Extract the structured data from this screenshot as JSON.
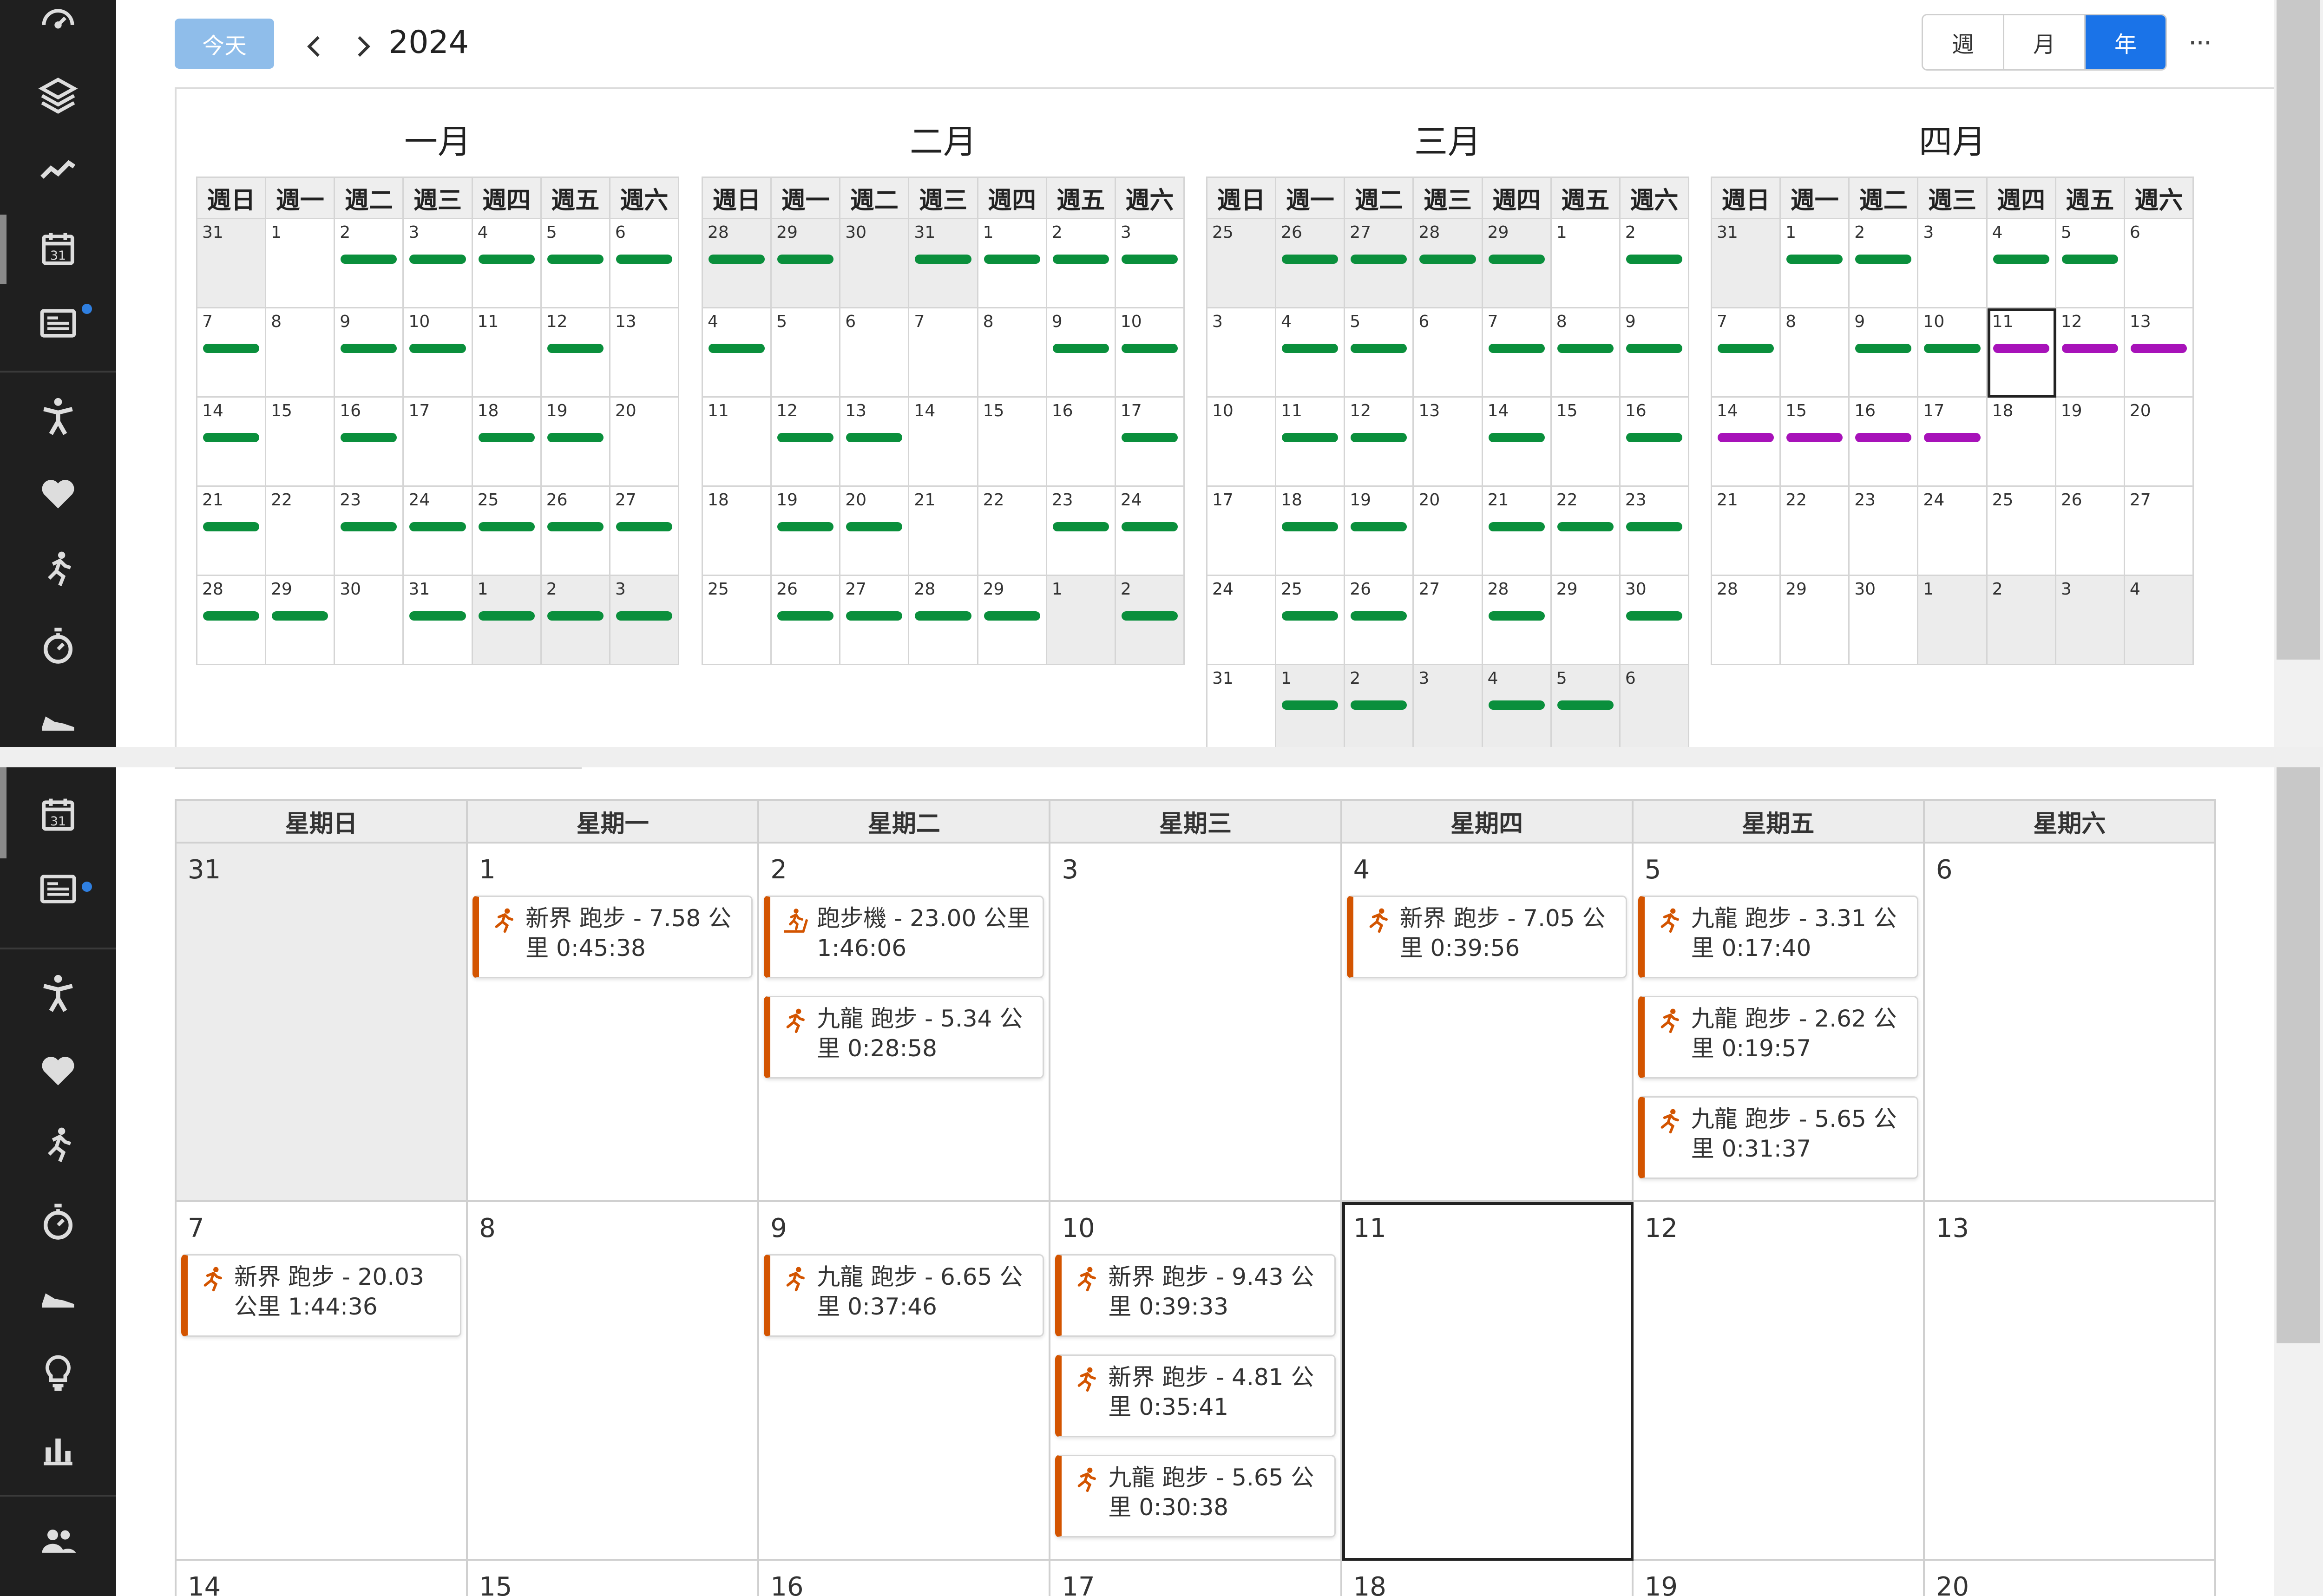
{
  "toolbar": {
    "today_label": "今天",
    "year": "2024",
    "views": [
      "週",
      "月",
      "年"
    ],
    "active_view": "年",
    "more_label": "···"
  },
  "colors": {
    "activity_bar": "#0a8f3c",
    "planned_bar": "#a712b9",
    "accent": "#1a73e8",
    "event_border": "#d35400"
  },
  "icons": {
    "sidebar_top": [
      "dashboard-icon",
      "layers-icon",
      "trend-icon",
      "calendar-icon",
      "news-icon",
      "activity-person-icon",
      "heart-icon",
      "run-icon",
      "stopwatch-icon",
      "shoe-icon"
    ],
    "sidebar_bottom": [
      "calendar-icon",
      "news-icon",
      "activity-person-icon",
      "heart-icon",
      "run-icon",
      "stopwatch-icon",
      "shoe-icon",
      "bulb-icon",
      "bar-chart-icon",
      "people-icon"
    ],
    "event": "running-icon",
    "event_treadmill": "treadmill-icon"
  },
  "year_view": {
    "weekday_headers": [
      "週日",
      "週一",
      "週二",
      "週三",
      "週四",
      "週五",
      "週六"
    ],
    "months": [
      {
        "name": "一月",
        "weeks": [
          [
            {
              "d": "31",
              "out": true
            },
            {
              "d": "1"
            },
            {
              "d": "2",
              "bar": "g"
            },
            {
              "d": "3",
              "bar": "g"
            },
            {
              "d": "4",
              "bar": "g"
            },
            {
              "d": "5",
              "bar": "g"
            },
            {
              "d": "6",
              "bar": "g"
            }
          ],
          [
            {
              "d": "7",
              "bar": "g"
            },
            {
              "d": "8"
            },
            {
              "d": "9",
              "bar": "g"
            },
            {
              "d": "10",
              "bar": "g"
            },
            {
              "d": "11"
            },
            {
              "d": "12",
              "bar": "g"
            },
            {
              "d": "13"
            }
          ],
          [
            {
              "d": "14",
              "bar": "g"
            },
            {
              "d": "15"
            },
            {
              "d": "16",
              "bar": "g"
            },
            {
              "d": "17"
            },
            {
              "d": "18",
              "bar": "g"
            },
            {
              "d": "19",
              "bar": "g"
            },
            {
              "d": "20"
            }
          ],
          [
            {
              "d": "21",
              "bar": "g"
            },
            {
              "d": "22"
            },
            {
              "d": "23",
              "bar": "g"
            },
            {
              "d": "24",
              "bar": "g"
            },
            {
              "d": "25",
              "bar": "g"
            },
            {
              "d": "26",
              "bar": "g"
            },
            {
              "d": "27",
              "bar": "g"
            }
          ],
          [
            {
              "d": "28",
              "bar": "g"
            },
            {
              "d": "29",
              "bar": "g"
            },
            {
              "d": "30"
            },
            {
              "d": "31",
              "bar": "g"
            },
            {
              "d": "1",
              "out": true,
              "bar": "g"
            },
            {
              "d": "2",
              "out": true,
              "bar": "g"
            },
            {
              "d": "3",
              "out": true,
              "bar": "g"
            }
          ]
        ]
      },
      {
        "name": "二月",
        "weeks": [
          [
            {
              "d": "28",
              "out": true,
              "bar": "g"
            },
            {
              "d": "29",
              "out": true,
              "bar": "g"
            },
            {
              "d": "30",
              "out": true
            },
            {
              "d": "31",
              "out": true,
              "bar": "g"
            },
            {
              "d": "1",
              "bar": "g"
            },
            {
              "d": "2",
              "bar": "g"
            },
            {
              "d": "3",
              "bar": "g"
            }
          ],
          [
            {
              "d": "4",
              "bar": "g"
            },
            {
              "d": "5"
            },
            {
              "d": "6"
            },
            {
              "d": "7"
            },
            {
              "d": "8"
            },
            {
              "d": "9",
              "bar": "g"
            },
            {
              "d": "10",
              "bar": "g"
            }
          ],
          [
            {
              "d": "11"
            },
            {
              "d": "12",
              "bar": "g"
            },
            {
              "d": "13",
              "bar": "g"
            },
            {
              "d": "14"
            },
            {
              "d": "15"
            },
            {
              "d": "16"
            },
            {
              "d": "17",
              "bar": "g"
            }
          ],
          [
            {
              "d": "18"
            },
            {
              "d": "19",
              "bar": "g"
            },
            {
              "d": "20",
              "bar": "g"
            },
            {
              "d": "21"
            },
            {
              "d": "22"
            },
            {
              "d": "23",
              "bar": "g"
            },
            {
              "d": "24",
              "bar": "g"
            }
          ],
          [
            {
              "d": "25"
            },
            {
              "d": "26",
              "bar": "g"
            },
            {
              "d": "27",
              "bar": "g"
            },
            {
              "d": "28",
              "bar": "g"
            },
            {
              "d": "29",
              "bar": "g"
            },
            {
              "d": "1",
              "out": true
            },
            {
              "d": "2",
              "out": true,
              "bar": "g"
            }
          ]
        ]
      },
      {
        "name": "三月",
        "weeks": [
          [
            {
              "d": "25",
              "out": true
            },
            {
              "d": "26",
              "out": true,
              "bar": "g"
            },
            {
              "d": "27",
              "out": true,
              "bar": "g"
            },
            {
              "d": "28",
              "out": true,
              "bar": "g"
            },
            {
              "d": "29",
              "out": true,
              "bar": "g"
            },
            {
              "d": "1"
            },
            {
              "d": "2",
              "bar": "g"
            }
          ],
          [
            {
              "d": "3"
            },
            {
              "d": "4",
              "bar": "g"
            },
            {
              "d": "5",
              "bar": "g"
            },
            {
              "d": "6"
            },
            {
              "d": "7",
              "bar": "g"
            },
            {
              "d": "8",
              "bar": "g"
            },
            {
              "d": "9",
              "bar": "g"
            }
          ],
          [
            {
              "d": "10"
            },
            {
              "d": "11",
              "bar": "g"
            },
            {
              "d": "12",
              "bar": "g"
            },
            {
              "d": "13"
            },
            {
              "d": "14",
              "bar": "g"
            },
            {
              "d": "15"
            },
            {
              "d": "16",
              "bar": "g"
            }
          ],
          [
            {
              "d": "17"
            },
            {
              "d": "18",
              "bar": "g"
            },
            {
              "d": "19",
              "bar": "g"
            },
            {
              "d": "20"
            },
            {
              "d": "21",
              "bar": "g"
            },
            {
              "d": "22",
              "bar": "g"
            },
            {
              "d": "23",
              "bar": "g"
            }
          ],
          [
            {
              "d": "24"
            },
            {
              "d": "25",
              "bar": "g"
            },
            {
              "d": "26",
              "bar": "g"
            },
            {
              "d": "27"
            },
            {
              "d": "28",
              "bar": "g"
            },
            {
              "d": "29"
            },
            {
              "d": "30",
              "bar": "g"
            }
          ],
          [
            {
              "d": "31"
            },
            {
              "d": "1",
              "out": true,
              "bar": "g"
            },
            {
              "d": "2",
              "out": true,
              "bar": "g"
            },
            {
              "d": "3",
              "out": true
            },
            {
              "d": "4",
              "out": true,
              "bar": "g"
            },
            {
              "d": "5",
              "out": true,
              "bar": "g"
            },
            {
              "d": "6",
              "out": true
            }
          ]
        ]
      },
      {
        "name": "四月",
        "weeks": [
          [
            {
              "d": "31",
              "out": true
            },
            {
              "d": "1",
              "bar": "g"
            },
            {
              "d": "2",
              "bar": "g"
            },
            {
              "d": "3"
            },
            {
              "d": "4",
              "bar": "g"
            },
            {
              "d": "5",
              "bar": "g"
            },
            {
              "d": "6"
            }
          ],
          [
            {
              "d": "7",
              "bar": "g"
            },
            {
              "d": "8"
            },
            {
              "d": "9",
              "bar": "g"
            },
            {
              "d": "10",
              "bar": "g"
            },
            {
              "d": "11",
              "bar": "p",
              "today": true
            },
            {
              "d": "12",
              "bar": "p"
            },
            {
              "d": "13",
              "bar": "p"
            }
          ],
          [
            {
              "d": "14",
              "bar": "p"
            },
            {
              "d": "15",
              "bar": "p"
            },
            {
              "d": "16",
              "bar": "p"
            },
            {
              "d": "17",
              "bar": "p"
            },
            {
              "d": "18"
            },
            {
              "d": "19"
            },
            {
              "d": "20"
            }
          ],
          [
            {
              "d": "21"
            },
            {
              "d": "22"
            },
            {
              "d": "23"
            },
            {
              "d": "24"
            },
            {
              "d": "25"
            },
            {
              "d": "26"
            },
            {
              "d": "27"
            }
          ],
          [
            {
              "d": "28"
            },
            {
              "d": "29"
            },
            {
              "d": "30"
            },
            {
              "d": "1",
              "out": true
            },
            {
              "d": "2",
              "out": true
            },
            {
              "d": "3",
              "out": true
            },
            {
              "d": "4",
              "out": true
            }
          ]
        ]
      }
    ]
  },
  "week_view": {
    "headers": [
      "星期日",
      "星期一",
      "星期二",
      "星期三",
      "星期四",
      "星期五",
      "星期六"
    ],
    "rows": [
      [
        {
          "d": "31",
          "out": true,
          "events": []
        },
        {
          "d": "1",
          "events": [
            {
              "text": "新界 跑步 - 7.58 公里 0:45:38"
            }
          ]
        },
        {
          "d": "2",
          "events": [
            {
              "text": "跑步機 - 23.00 公里 1:46:06",
              "icon": "treadmill"
            },
            {
              "text": "九龍 跑步 - 5.34 公里 0:28:58"
            }
          ]
        },
        {
          "d": "3",
          "events": []
        },
        {
          "d": "4",
          "events": [
            {
              "text": "新界 跑步 - 7.05 公里 0:39:56"
            }
          ]
        },
        {
          "d": "5",
          "events": [
            {
              "text": "九龍 跑步 - 3.31 公里 0:17:40"
            },
            {
              "text": "九龍 跑步 - 2.62 公里 0:19:57"
            },
            {
              "text": "九龍 跑步 - 5.65 公里 0:31:37"
            }
          ]
        },
        {
          "d": "6",
          "events": []
        }
      ],
      [
        {
          "d": "7",
          "events": [
            {
              "text": "新界 跑步 - 20.03 公里 1:44:36"
            }
          ]
        },
        {
          "d": "8",
          "events": []
        },
        {
          "d": "9",
          "events": [
            {
              "text": "九龍 跑步 - 6.65 公里 0:37:46"
            }
          ]
        },
        {
          "d": "10",
          "events": [
            {
              "text": "新界 跑步 - 9.43 公里 0:39:33"
            },
            {
              "text": "新界 跑步 - 4.81 公里 0:35:41"
            },
            {
              "text": "九龍 跑步 - 5.65 公里 0:30:38"
            }
          ]
        },
        {
          "d": "11",
          "today": true,
          "events": []
        },
        {
          "d": "12",
          "events": []
        },
        {
          "d": "13",
          "events": []
        }
      ],
      [
        {
          "d": "14",
          "events": []
        },
        {
          "d": "15",
          "events": []
        },
        {
          "d": "16",
          "events": []
        },
        {
          "d": "17",
          "events": []
        },
        {
          "d": "18",
          "events": []
        },
        {
          "d": "19",
          "events": []
        },
        {
          "d": "20",
          "events": []
        }
      ]
    ]
  }
}
